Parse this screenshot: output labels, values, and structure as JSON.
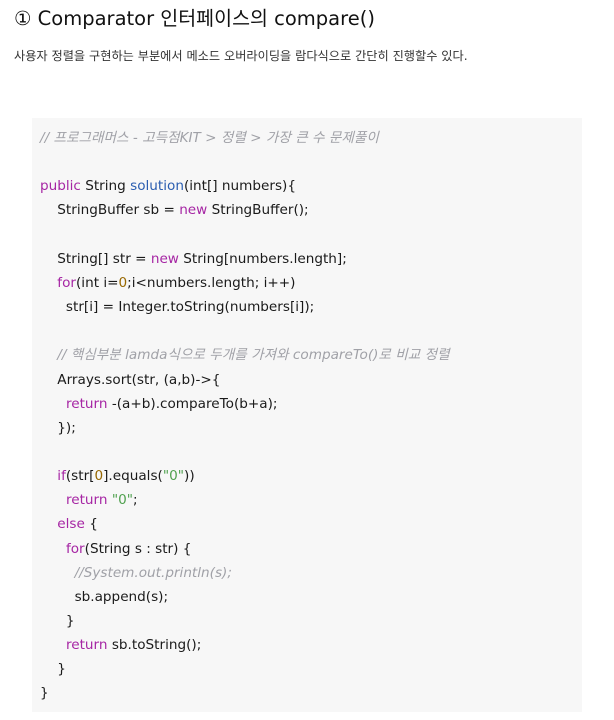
{
  "heading": "① Comparator 인터페이스의 compare()",
  "description": "사용자 정렬을 구현하는 부분에서 메소드 오버라이딩을 람다식으로 간단히 진행할수 있다.",
  "code_lines": [
    [
      {
        "t": "// 프로그래머스 - 고득점KIT > 정렬 > 가장 큰 수 문제풀이",
        "c": "comment"
      }
    ],
    [],
    [
      {
        "t": "public",
        "c": "keyword"
      },
      {
        "t": " String ",
        "c": "plain"
      },
      {
        "t": "solution",
        "c": "func"
      },
      {
        "t": "(int[] numbers){",
        "c": "plain"
      }
    ],
    [
      {
        "t": "    StringBuffer sb = ",
        "c": "plain"
      },
      {
        "t": "new",
        "c": "keyword"
      },
      {
        "t": " StringBuffer();",
        "c": "plain"
      }
    ],
    [],
    [
      {
        "t": "    String[] str = ",
        "c": "plain"
      },
      {
        "t": "new",
        "c": "keyword"
      },
      {
        "t": " String[numbers.length];",
        "c": "plain"
      }
    ],
    [
      {
        "t": "    ",
        "c": "plain"
      },
      {
        "t": "for",
        "c": "keyword"
      },
      {
        "t": "(int i=",
        "c": "plain"
      },
      {
        "t": "0",
        "c": "number"
      },
      {
        "t": ";i<numbers.length; i++)",
        "c": "plain"
      }
    ],
    [
      {
        "t": "      str[i] = Integer.toString(numbers[i]);",
        "c": "plain"
      }
    ],
    [],
    [
      {
        "t": "    // 핵심부분 lamda식으로 두개를 가져와 compareTo()로 비교 정렬",
        "c": "comment"
      }
    ],
    [
      {
        "t": "    Arrays.sort(str, (a,b)->{",
        "c": "plain"
      }
    ],
    [
      {
        "t": "      ",
        "c": "plain"
      },
      {
        "t": "return",
        "c": "keyword"
      },
      {
        "t": " -(a+b).compareTo(b+a);",
        "c": "plain"
      }
    ],
    [
      {
        "t": "    });",
        "c": "plain"
      }
    ],
    [],
    [
      {
        "t": "    ",
        "c": "plain"
      },
      {
        "t": "if",
        "c": "keyword"
      },
      {
        "t": "(str[",
        "c": "plain"
      },
      {
        "t": "0",
        "c": "number"
      },
      {
        "t": "].equals(",
        "c": "plain"
      },
      {
        "t": "\"0\"",
        "c": "string"
      },
      {
        "t": "))",
        "c": "plain"
      }
    ],
    [
      {
        "t": "      ",
        "c": "plain"
      },
      {
        "t": "return",
        "c": "keyword"
      },
      {
        "t": " ",
        "c": "plain"
      },
      {
        "t": "\"0\"",
        "c": "string"
      },
      {
        "t": ";",
        "c": "plain"
      }
    ],
    [
      {
        "t": "    ",
        "c": "plain"
      },
      {
        "t": "else",
        "c": "keyword"
      },
      {
        "t": " {",
        "c": "plain"
      }
    ],
    [
      {
        "t": "      ",
        "c": "plain"
      },
      {
        "t": "for",
        "c": "keyword"
      },
      {
        "t": "(String s : str) {",
        "c": "plain"
      }
    ],
    [
      {
        "t": "        //System.out.println(s);",
        "c": "comment"
      }
    ],
    [
      {
        "t": "        sb.append(s);",
        "c": "plain"
      }
    ],
    [
      {
        "t": "      }",
        "c": "plain"
      }
    ],
    [
      {
        "t": "      ",
        "c": "plain"
      },
      {
        "t": "return",
        "c": "keyword"
      },
      {
        "t": " sb.toString();",
        "c": "plain"
      }
    ],
    [
      {
        "t": "    }",
        "c": "plain"
      }
    ],
    [
      {
        "t": "}",
        "c": "plain"
      }
    ]
  ]
}
